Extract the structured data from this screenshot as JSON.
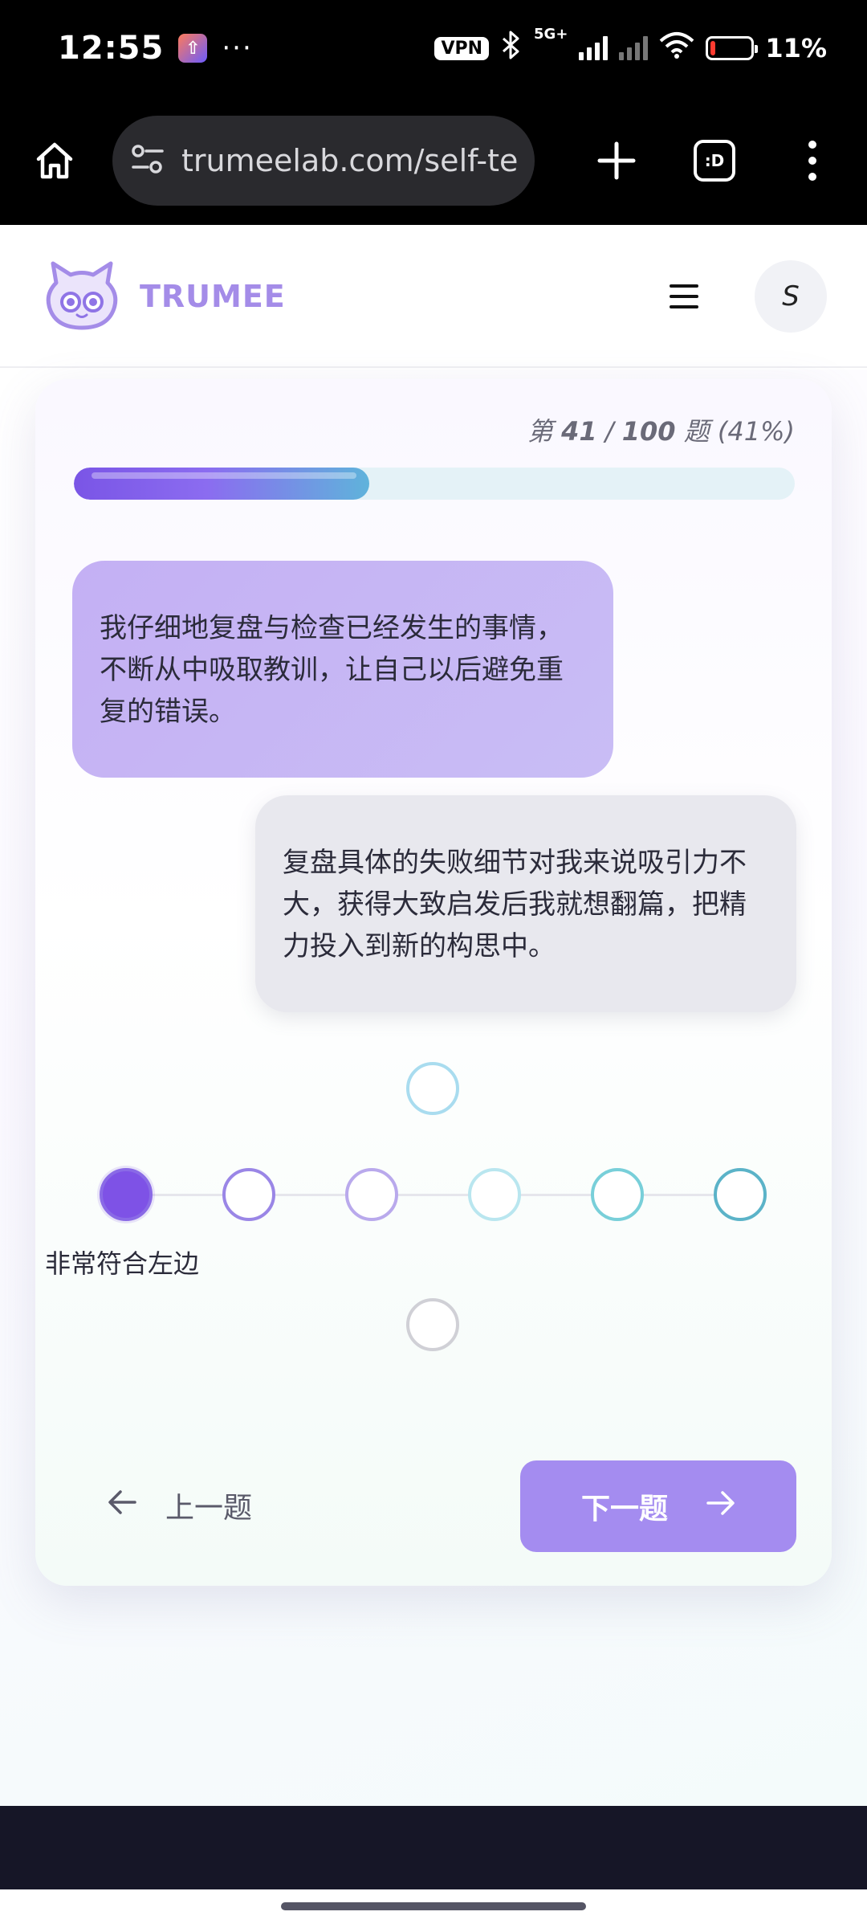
{
  "status_bar": {
    "time": "12:55",
    "more": "···",
    "vpn": "VPN",
    "network": "5G+",
    "battery_pct": "11%",
    "battery_level": 0.11
  },
  "browser": {
    "url": "trumeelab.com/self-te",
    "tab_label": ":D"
  },
  "header": {
    "brand": "TRUMEE",
    "avatar_letter": "S"
  },
  "quiz": {
    "progress_prefix": "第 ",
    "progress_current": "41",
    "progress_sep": " / ",
    "progress_total": "100",
    "progress_suffix": " 题 ",
    "progress_percent": "(41%)",
    "progress_fraction": 0.41,
    "statement_left": "我仔细地复盘与检查已经发生的事情，不断从中吸取教训，让自己以后避免重复的错误。",
    "statement_right": "复盘具体的失败细节对我来说吸引力不大，获得大致启发后我就想翻篇，把精力投入到新的构思中。",
    "selected_caption": "非常符合左边",
    "scale_colors": [
      "#8a6ae6",
      "#9a86e6",
      "#b9a9ec",
      "#b9e6ef",
      "#78cfd9",
      "#5bb3c8"
    ],
    "selected_index": 0
  },
  "nav": {
    "prev_label": "上一题",
    "next_label": "下一题"
  }
}
